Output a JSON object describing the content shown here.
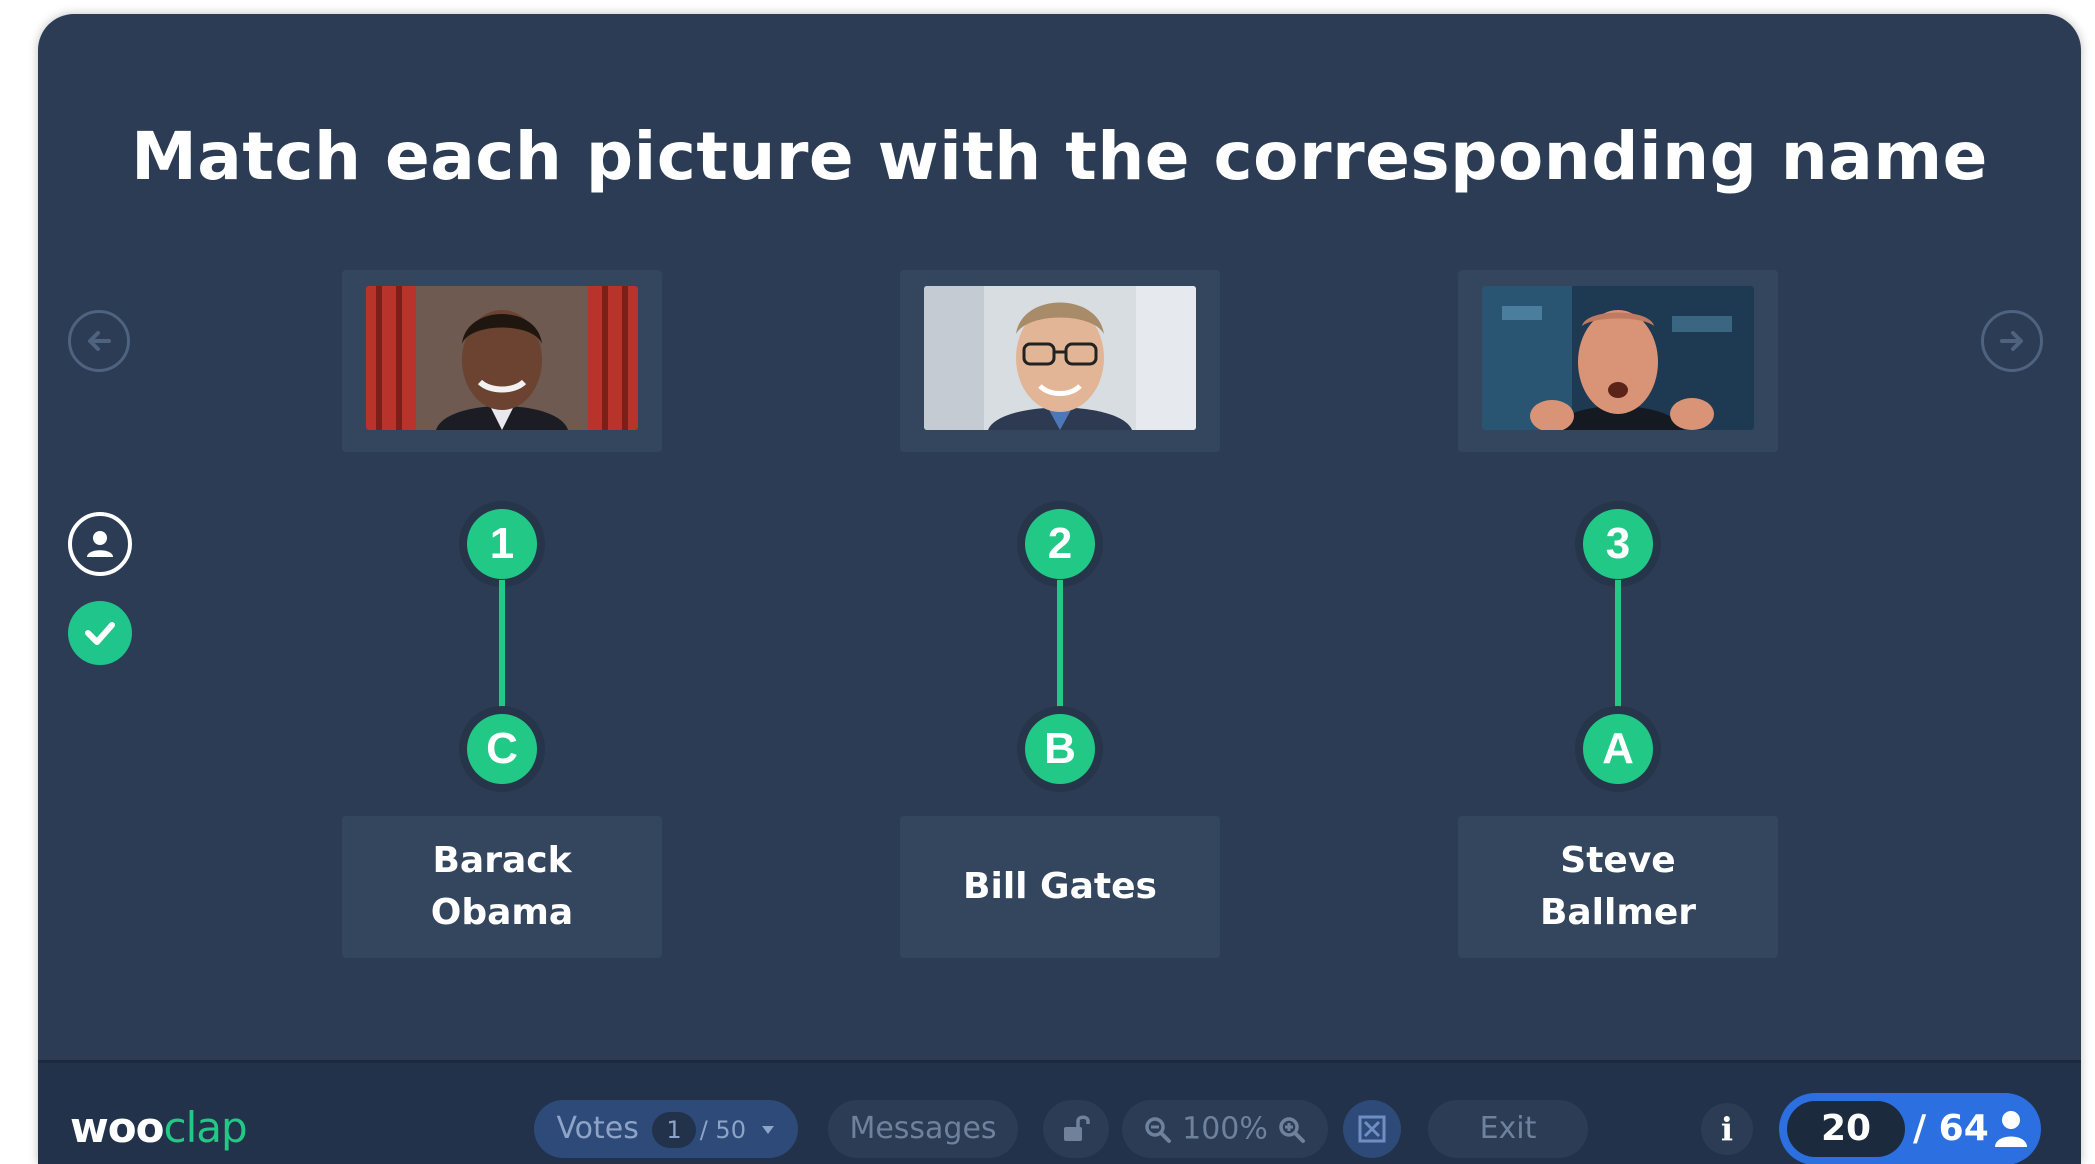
{
  "question": {
    "title": "Match each picture with the corresponding name"
  },
  "pairs": [
    {
      "number": "1",
      "letter": "C",
      "name": "Barack Obama"
    },
    {
      "number": "2",
      "letter": "B",
      "name": "Bill Gates"
    },
    {
      "number": "3",
      "letter": "A",
      "name": "Steve Ballmer"
    }
  ],
  "footer": {
    "logo_main": "woo",
    "logo_accent": "clap",
    "votes_label": "Votes",
    "votes_count": "1",
    "votes_total": "/ 50",
    "messages_label": "Messages",
    "zoom_level": "100%",
    "exit_label": "Exit",
    "info_label": "i",
    "participants_current": "20",
    "participants_total": "/ 64"
  },
  "colors": {
    "background": "#2b3c54",
    "card": "#34465e",
    "accent": "#22c886",
    "participants_pill": "#2b6fe0"
  },
  "icons": [
    "arrow-left-icon",
    "arrow-right-icon",
    "user-icon",
    "check-icon",
    "chevron-down-icon",
    "lock-icon",
    "zoom-out-icon",
    "zoom-in-icon",
    "fullscreen-icon",
    "info-icon",
    "person-icon"
  ]
}
